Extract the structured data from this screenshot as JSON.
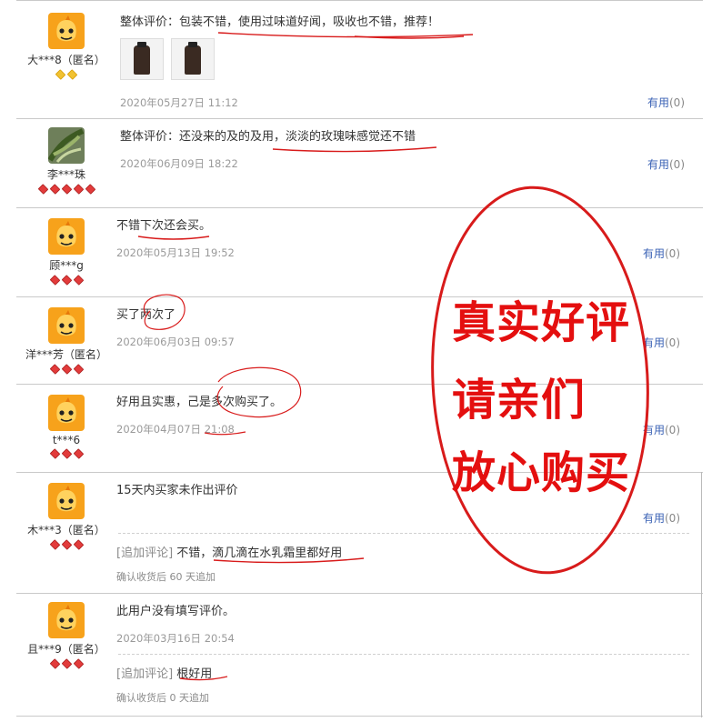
{
  "reviews": [
    {
      "username": "大***8（匿名）",
      "badge_type": "gold",
      "badge_count": 2,
      "text": "整体评价：包装不错，使用过味道好闻，吸收也不错，推荐！",
      "date": "2020年05月27日 11:12",
      "useful_label": "有用",
      "useful_count": "(0)"
    },
    {
      "username": "李***珠",
      "badge_type": "red",
      "badge_count": 5,
      "text": "整体评价：还没来的及的及用，淡淡的玫瑰味感觉还不错",
      "date": "2020年06月09日 18:22",
      "useful_label": "有用",
      "useful_count": "(0)"
    },
    {
      "username": "顾***g",
      "badge_type": "red",
      "badge_count": 3,
      "text": "不错下次还会买。",
      "date": "2020年05月13日 19:52",
      "useful_label": "有用",
      "useful_count": "(0)"
    },
    {
      "username": "洋***芳（匿名）",
      "badge_type": "red",
      "badge_count": 3,
      "text": "买了两次了",
      "date": "2020年06月03日 09:57",
      "useful_label": "有用",
      "useful_count": "(0)"
    },
    {
      "username": "t***6",
      "badge_type": "red",
      "badge_count": 3,
      "text": "好用且实惠，己是多次购买了。",
      "date": "2020年04月07日 21:08",
      "useful_label": "有用",
      "useful_count": "(0)"
    },
    {
      "username": "木***3（匿名）",
      "badge_type": "red",
      "badge_count": 3,
      "text": "15天内买家未作出评价",
      "useful_label": "有用",
      "useful_count": "(0)",
      "append_tag": "[追加评论]",
      "append_text": "不错，滴几滴在水乳霜里都好用",
      "append_date": "确认收货后 60 天追加"
    },
    {
      "username": "且***9（匿名）",
      "badge_type": "red",
      "badge_count": 3,
      "text": "此用户没有填写评价。",
      "date": "2020年03月16日 20:54",
      "append_tag": "[追加评论]",
      "append_text": "根好用",
      "append_date": "确认收货后 0 天追加"
    }
  ],
  "promo": {
    "line1": "真实好评",
    "line2": "请亲们",
    "line3": "放心购买"
  },
  "colors": {
    "promo_red": "#e40f0f",
    "link_blue": "#3a62b5",
    "avatar_orange": "#f7a21b"
  }
}
